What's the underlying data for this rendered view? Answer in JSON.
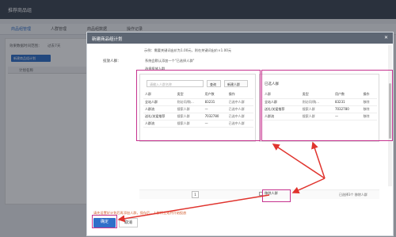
{
  "app": {
    "title": "推荐商品组"
  },
  "tabs": [
    {
      "label": "商品组管理"
    },
    {
      "label": "人群管理"
    },
    {
      "label": "商品组数据"
    },
    {
      "label": "操作记录"
    }
  ],
  "background": {
    "filter_label": "效果数据时间范围：",
    "filter_value": "过去7天",
    "new_button": "新建商品组计划",
    "col_head": "计划名称"
  },
  "modal": {
    "title": "新建商品组计划",
    "close_icon": "close-icon",
    "hint_text": "示例：需要关键词出价为1.00元，则在关键词出价×1.00元",
    "audience_label": "投放人群：",
    "audience_mode": "系统会默认添加一个\"已选择人群\"",
    "select_label": "选择投放人群",
    "search_placeholder": "请输入人群名称",
    "query_button": "查询",
    "new_audience_button": "新建人群",
    "left_headers": [
      "人群",
      "类型",
      "用户数",
      "操作"
    ],
    "left_rows": [
      {
        "name": "全站人群",
        "type": "则访问/购…",
        "count": "83231",
        "op": "已选中人群"
      },
      {
        "name": "人群流",
        "type": "搜索人群",
        "count": "—",
        "op": "已选中人群"
      },
      {
        "name": "送礼/关爱推荐",
        "type": "搜索人群",
        "count": "7032780",
        "op": "已选中人群"
      },
      {
        "name": "人群流",
        "type": "搜索人群",
        "count": "—",
        "op": "已选中人群"
      }
    ],
    "right_title": "已选人群",
    "right_headers": [
      "人群",
      "类型",
      "用户数",
      "操作"
    ],
    "right_rows": [
      {
        "name": "全站人群",
        "type": "则访问/购…",
        "count": "83231",
        "op": "移除"
      },
      {
        "name": "送礼/关爱推荐",
        "type": "搜索人群",
        "count": "7032780",
        "op": "移除"
      },
      {
        "name": "人群流",
        "type": "搜索人群",
        "count": "—",
        "op": "移除"
      }
    ],
    "pager": "1",
    "remove_label": "移除人群",
    "selected_summary": "已选择3个 移除人群",
    "notice": "请先设置好计划后再添加人群，保存后，人群将生效并开始投放",
    "confirm": "确定",
    "cancel": "取消"
  },
  "watermark": "Bai du 经验",
  "colors": {
    "accent": "#2f6fc9",
    "annotation": "#c6338f",
    "arrow": "#e0342e"
  }
}
